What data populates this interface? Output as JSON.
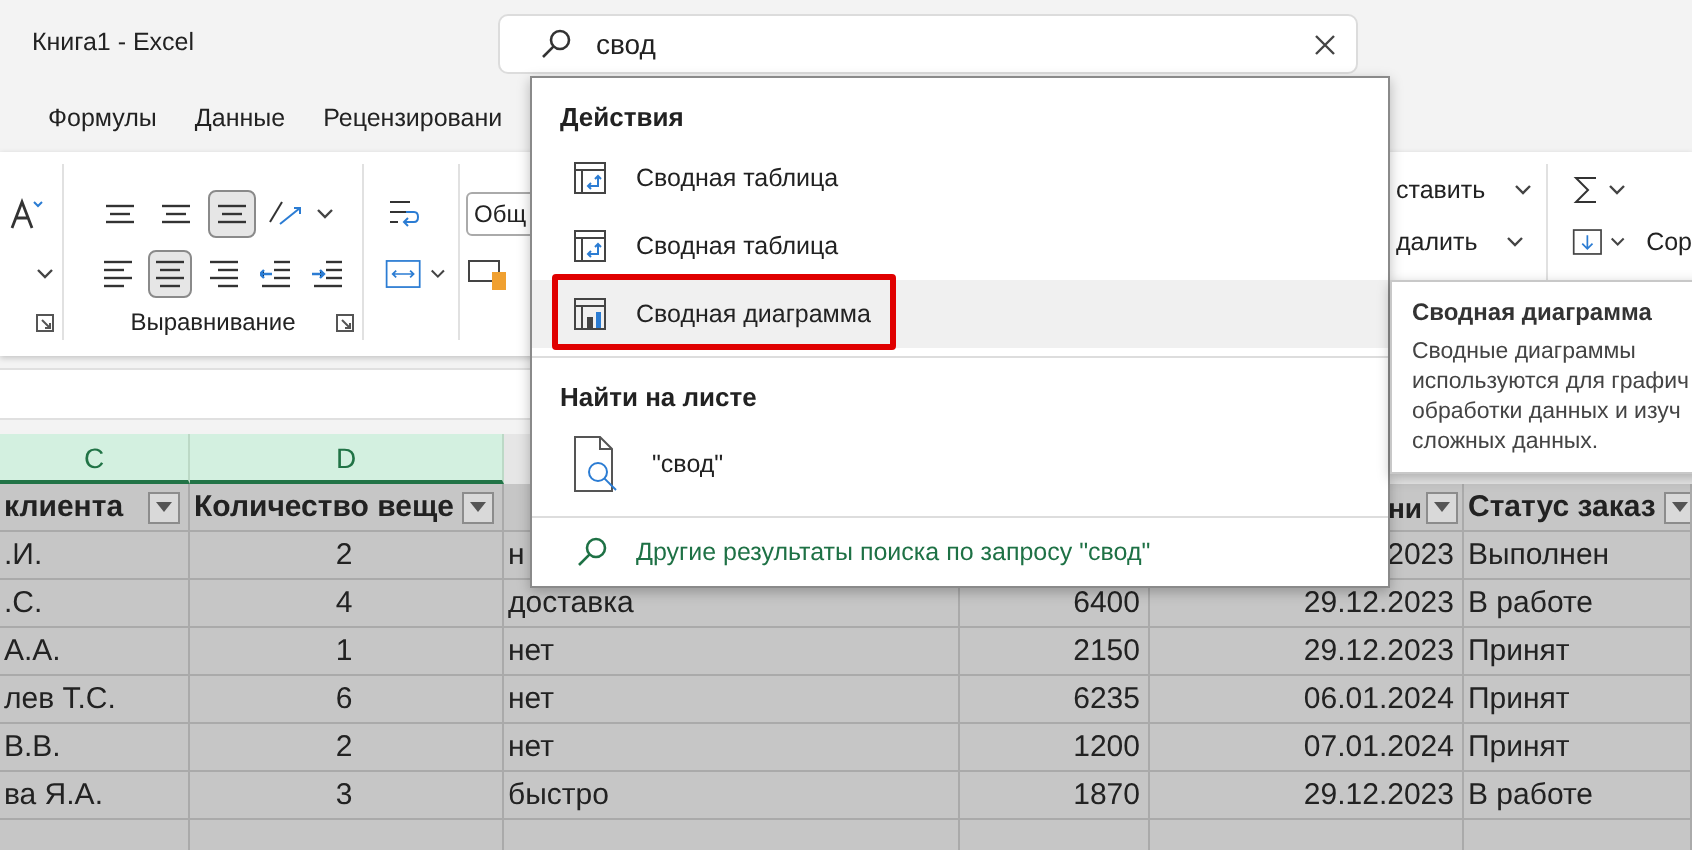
{
  "window": {
    "title": "Книга1 - Excel"
  },
  "search": {
    "value": "свод"
  },
  "ribbon_tabs": [
    "Формулы",
    "Данные",
    "Рецензировани"
  ],
  "ribbon": {
    "alignment_buttons": [
      {
        "kind": "top",
        "pressed": false
      },
      {
        "kind": "middle",
        "pressed": false
      },
      {
        "kind": "bottom",
        "pressed": true
      },
      {
        "kind": "left",
        "pressed": false
      },
      {
        "kind": "center",
        "pressed": true
      },
      {
        "kind": "right",
        "pressed": false
      },
      {
        "kind": "outdent",
        "pressed": false
      },
      {
        "kind": "indent",
        "pressed": false
      }
    ],
    "alignment_label": "Выравнивание",
    "number_format": "Общ",
    "cells_commands": [
      "ставить",
      "далить"
    ],
    "editing_label": "Сор"
  },
  "column_headers": [
    {
      "label": "C",
      "selected": true
    },
    {
      "label": "D",
      "selected": true
    }
  ],
  "table": {
    "selected": true,
    "header": {
      "column_1": "клиента",
      "column_2": "Количество веще",
      "column_5": "ни",
      "column_6": "Статус заказ"
    },
    "rows": [
      {
        "column_1": ".И.",
        "column_2": "2",
        "column_3": "н",
        "column_5": "2023",
        "column_6": "Выполнен"
      },
      {
        "column_1": ".С.",
        "column_2": "4",
        "column_3": "доставка",
        "column_4": "6400",
        "column_5": "29.12.2023",
        "column_6": "В работе"
      },
      {
        "column_1": "А.А.",
        "column_2": "1",
        "column_3": "нет",
        "column_4": "2150",
        "column_5": "29.12.2023",
        "column_6": "Принят"
      },
      {
        "column_1": "лев Т.С.",
        "column_2": "6",
        "column_3": "нет",
        "column_4": "6235",
        "column_5": "06.01.2024",
        "column_6": "Принят"
      },
      {
        "column_1": "В.В.",
        "column_2": "2",
        "column_3": "нет",
        "column_4": "1200",
        "column_5": "07.01.2024",
        "column_6": "Принят"
      },
      {
        "column_1": "ва Я.А.",
        "column_2": "3",
        "column_3": "быстро",
        "column_4": "1870",
        "column_5": "29.12.2023",
        "column_6": "В работе"
      }
    ]
  },
  "search_results": {
    "sections": [
      {
        "heading": "Действия",
        "items": [
          {
            "label": "Сводная таблица",
            "kind": "pivot-table",
            "selected": false,
            "outlined": false
          },
          {
            "label": "Сводная таблица",
            "kind": "pivot-table",
            "selected": false,
            "outlined": false
          },
          {
            "label": "Сводная диаграмма",
            "kind": "pivot-chart",
            "selected": true,
            "outlined": true
          }
        ]
      },
      {
        "heading": "Найти на листе",
        "items": [
          {
            "label": "\"свод\"",
            "kind": "find",
            "selected": false,
            "outlined": false
          }
        ]
      }
    ],
    "more_link": "Другие результаты поиска по запросу \"свод\""
  },
  "tooltip": {
    "title": "Сводная диаграмма",
    "lines": [
      "Сводные диаграммы",
      "используются для графич",
      "обработки данных и изуч",
      "сложных данных."
    ]
  }
}
